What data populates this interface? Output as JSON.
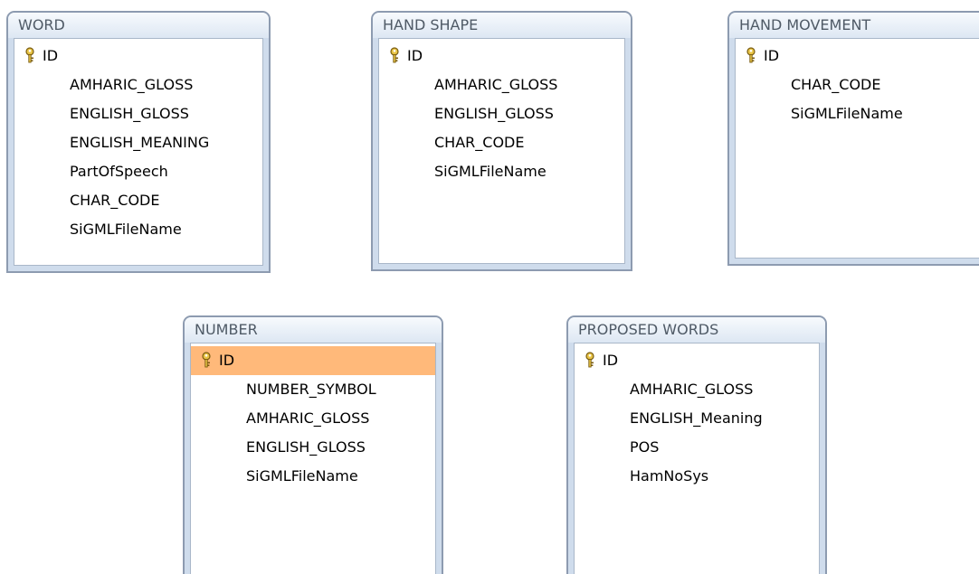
{
  "tables": [
    {
      "title": "WORD",
      "fields": [
        "ID",
        "AMHARIC_GLOSS",
        "ENGLISH_GLOSS",
        "ENGLISH_MEANING",
        "PartOfSpeech",
        "CHAR_CODE",
        "SiGMLFileName"
      ],
      "primary_key": "ID"
    },
    {
      "title": "HAND SHAPE",
      "fields": [
        "ID",
        "AMHARIC_GLOSS",
        "ENGLISH_GLOSS",
        "CHAR_CODE",
        "SiGMLFileName"
      ],
      "primary_key": "ID"
    },
    {
      "title": "HAND MOVEMENT",
      "fields": [
        "ID",
        "CHAR_CODE",
        "SiGMLFileName"
      ],
      "primary_key": "ID"
    },
    {
      "title": "NUMBER",
      "fields": [
        "ID",
        "NUMBER_SYMBOL",
        "AMHARIC_GLOSS",
        "ENGLISH_GLOSS",
        "SiGMLFileName"
      ],
      "primary_key": "ID",
      "selected_field": "ID"
    },
    {
      "title": "PROPOSED WORDS",
      "fields": [
        "ID",
        "AMHARIC_GLOSS",
        "ENGLISH_Meaning",
        "POS",
        "HamNoSys"
      ],
      "primary_key": "ID"
    }
  ],
  "colors": {
    "selection": "#ffb97a",
    "key_icon": "#c9a21f",
    "frame": "#cfdcec"
  },
  "icons": {
    "primary_key": "key-icon"
  }
}
